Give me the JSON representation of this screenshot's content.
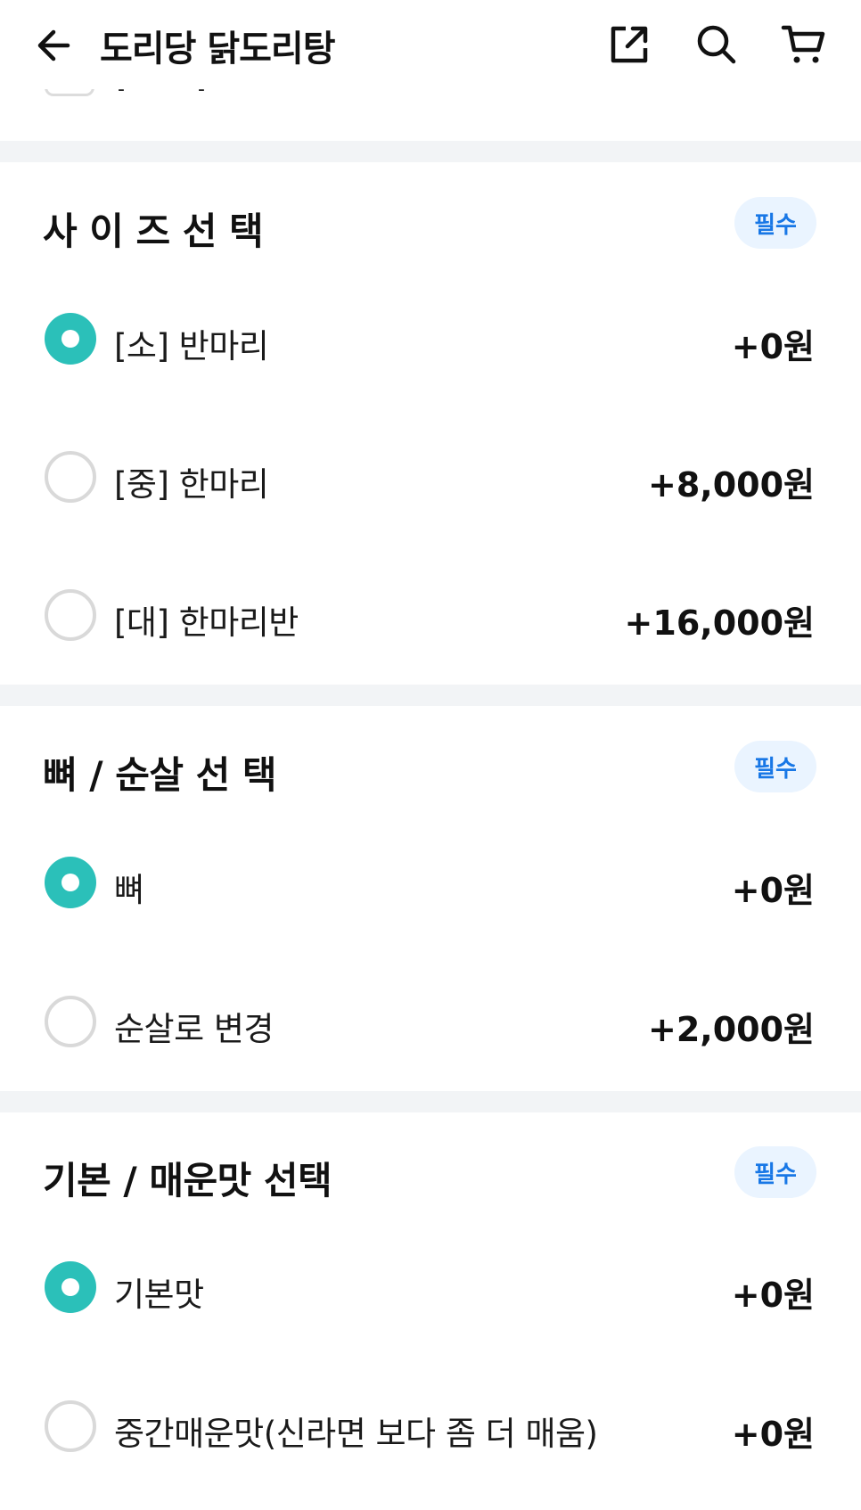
{
  "header": {
    "title": "도리당 닭도리탕",
    "back_icon": "arrow-left-icon",
    "share_icon": "share-icon",
    "search_icon": "search-icon",
    "cart_icon": "cart-icon"
  },
  "peek": {
    "dash_a": "-",
    "dash_b": "-"
  },
  "sections": [
    {
      "title": "사 이 즈 선 택",
      "badge": "필수",
      "options": [
        {
          "label": "[소] 반마리",
          "price": "+0원",
          "selected": true
        },
        {
          "label": "[중] 한마리",
          "price": "+8,000원",
          "selected": false
        },
        {
          "label": "[대] 한마리반",
          "price": "+16,000원",
          "selected": false
        }
      ]
    },
    {
      "title": "뼈 / 순살 선 택",
      "badge": "필수",
      "options": [
        {
          "label": "뼈",
          "price": "+0원",
          "selected": true
        },
        {
          "label": "순살로 변경",
          "price": "+2,000원",
          "selected": false
        }
      ]
    },
    {
      "title": "기본 / 매운맛 선택",
      "badge": "필수",
      "options": [
        {
          "label": "기본맛",
          "price": "+0원",
          "selected": true
        },
        {
          "label": "중간매운맛(신라면 보다 좀 더 매움)",
          "price": "+0원",
          "selected": false
        }
      ]
    }
  ],
  "colors": {
    "accent": "#2bc0b9",
    "badge_bg": "#eaf4ff",
    "badge_text": "#1877e6",
    "divider": "#f2f4f6"
  }
}
